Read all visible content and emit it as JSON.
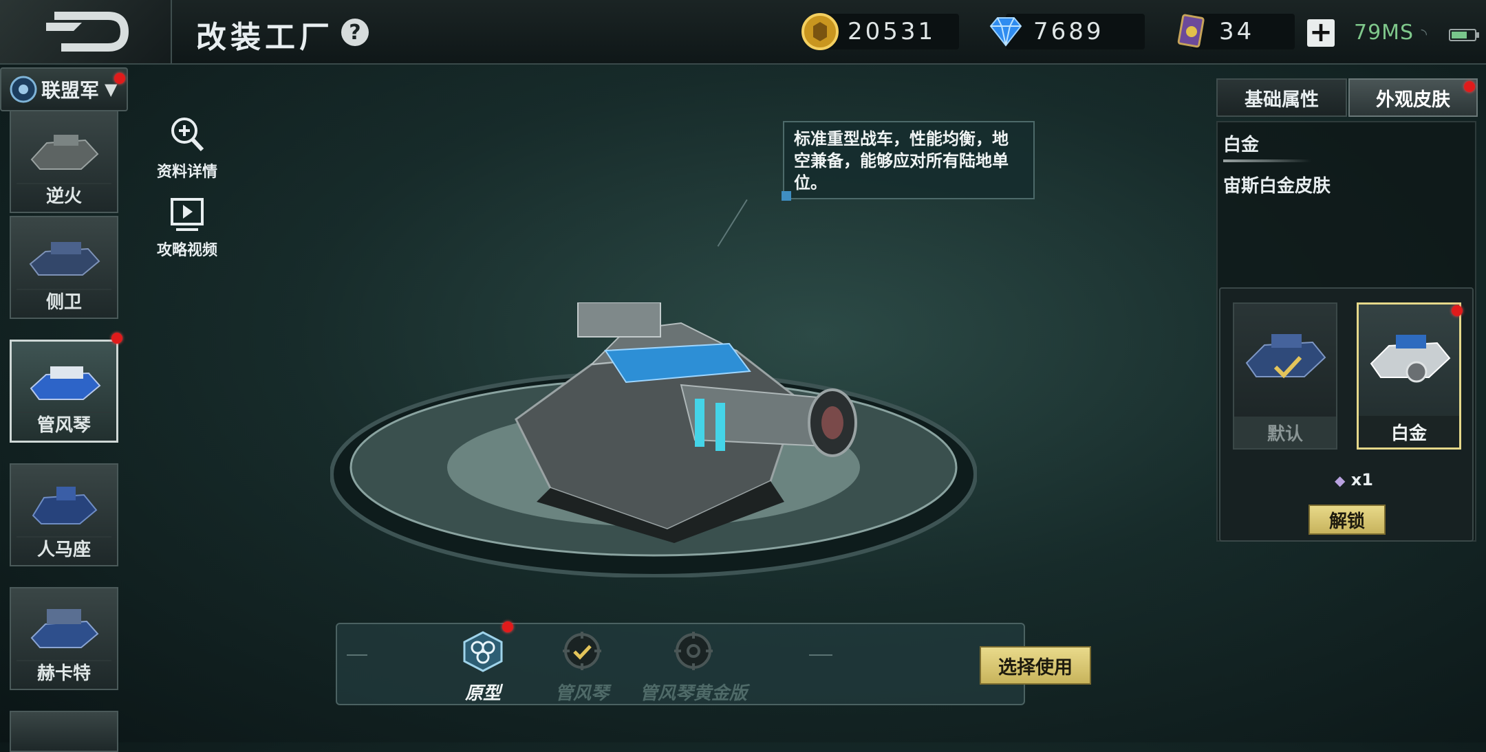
{
  "header": {
    "title": "改装工厂",
    "help": "?",
    "resources": {
      "gold": "20531",
      "diamond": "7689",
      "card": "34"
    },
    "plus": "+",
    "ping": "79MS"
  },
  "battery_level": 0.7,
  "faction": {
    "label": "联盟军"
  },
  "units": [
    {
      "name": "逆火"
    },
    {
      "name": "侧卫"
    },
    {
      "name": "管风琴"
    },
    {
      "name": "人马座"
    },
    {
      "name": "赫卡特"
    }
  ],
  "side_actions": {
    "details": "资料详情",
    "video": "攻略视频"
  },
  "tooltip": {
    "text": "标准重型战车，性能均衡，地空兼备，能够应对所有陆地单位。"
  },
  "tabs": {
    "basic": "基础属性",
    "skin": "外观皮肤"
  },
  "skin": {
    "title": "白金",
    "description": "宙斯白金皮肤",
    "cards": {
      "default": "默认",
      "platinum": "白金"
    },
    "cost": "x1",
    "unlock": "解锁"
  },
  "variants": {
    "prototype": "原型",
    "organ": "管风琴",
    "organ_gold": "管风琴黄金版"
  },
  "select_button": "选择使用",
  "colors": {
    "accent_gold": "#e8d989",
    "alert_red": "#e11b1b",
    "ping_green": "#7fc88b"
  }
}
